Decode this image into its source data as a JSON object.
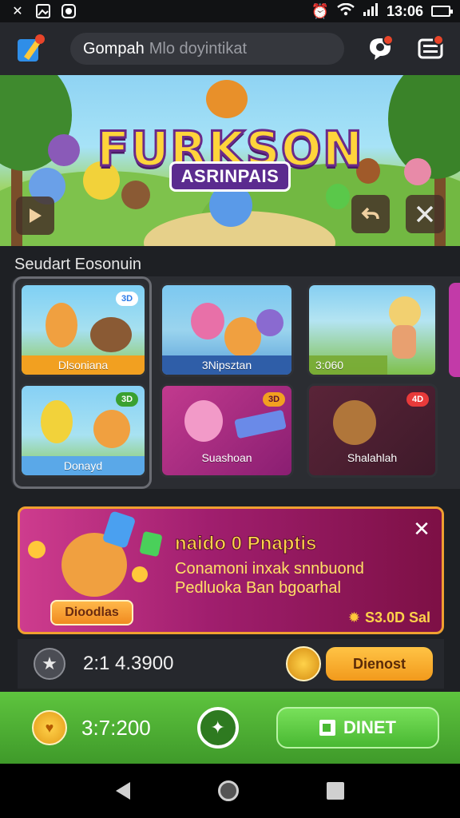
{
  "status_bar": {
    "time": "13:06",
    "left_icons": [
      "tools-icon",
      "image-icon",
      "lens-icon"
    ],
    "right_icons": [
      "alarm-icon",
      "wifi-icon",
      "signal-icon",
      "battery-icon"
    ]
  },
  "header": {
    "search_bold": "Gomp​ah",
    "search_placeholder": "Mlo doyintikat",
    "chat_icon": "chat-bubble-icon",
    "menu_icon": "menu-icon"
  },
  "hero": {
    "title": "FURKSON",
    "subtitle": "ASRINPAIS"
  },
  "section": {
    "title": "Seudart Eosonuin"
  },
  "cards": [
    {
      "label": "Dlsoniana",
      "tag": "3D"
    },
    {
      "label": "3Nipsztan",
      "tag": ""
    },
    {
      "label": "3:060",
      "tag": ""
    },
    {
      "label": "Donayd",
      "tag": "3D"
    },
    {
      "label": "Suashoan",
      "tag": "3D"
    },
    {
      "label": "Shalahlah",
      "tag": "4D"
    }
  ],
  "promo": {
    "title": "naido 0 Pnaptis",
    "line1": "Conamoni inxak snnbuond",
    "line2": "Pedluoka Ban bgoarhal",
    "button": "Dioodlas",
    "price": "S3.0D Sal"
  },
  "balance": {
    "value": "2:1 4.3900",
    "button": "Dienost"
  },
  "bottom_bar": {
    "coins": "3:7:200",
    "button": "DINET"
  },
  "colors": {
    "accent_orange": "#f29a1c",
    "green": "#49b832",
    "promo_magenta": "#a01e6e"
  }
}
